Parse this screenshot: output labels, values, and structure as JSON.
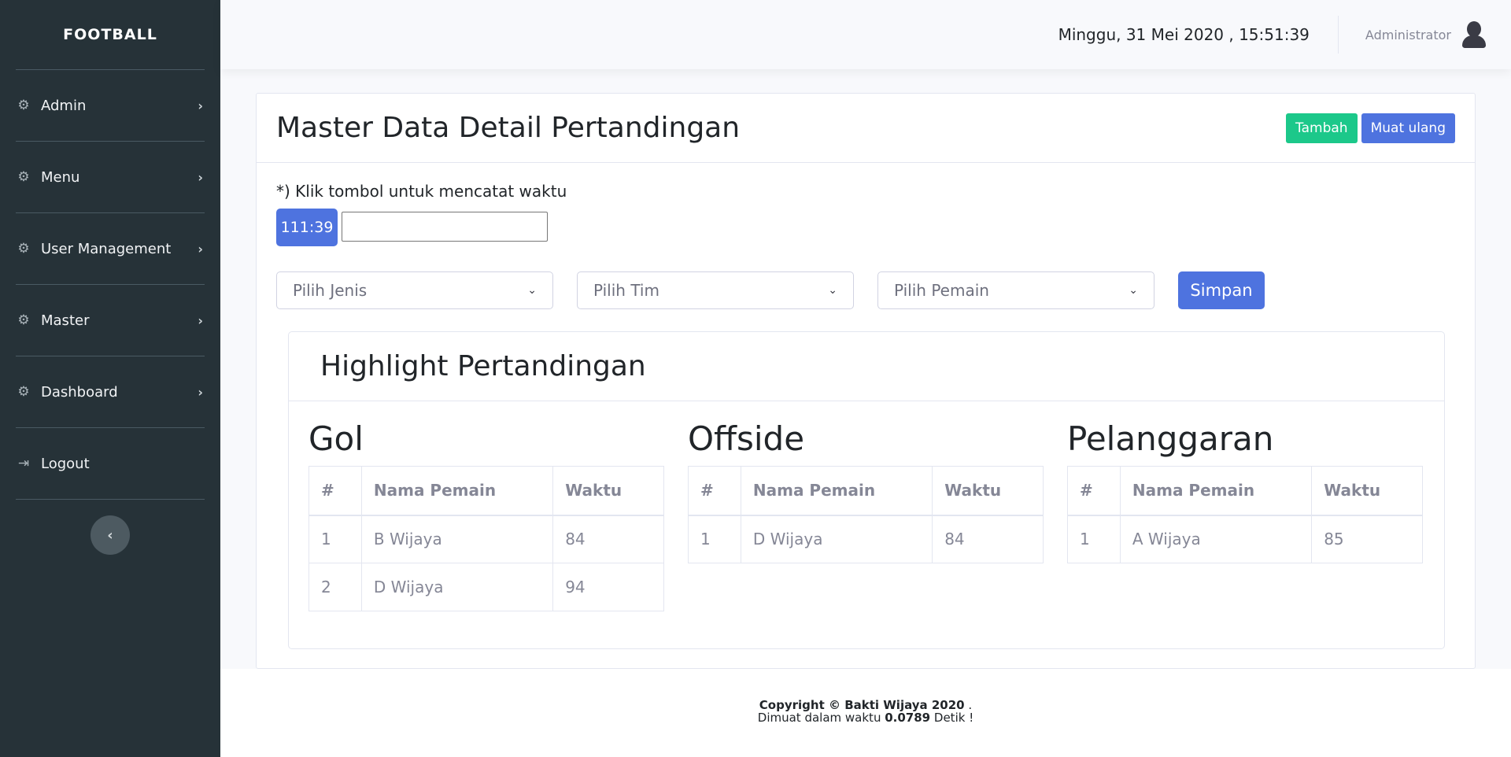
{
  "app": {
    "brand": "FOOTBALL"
  },
  "sidebar": {
    "items": [
      {
        "label": "Admin",
        "icon": "gear-icon"
      },
      {
        "label": "Menu",
        "icon": "gear-icon"
      },
      {
        "label": "User Management",
        "icon": "gear-icon"
      },
      {
        "label": "Master",
        "icon": "gear-icon"
      },
      {
        "label": "Dashboard",
        "icon": "gear-icon"
      }
    ],
    "logout_label": "Logout"
  },
  "topbar": {
    "datetime": "Minggu, 31 Mei 2020 , 15:51:39",
    "user_name": "Administrator"
  },
  "page": {
    "title": "Master Data Detail Pertandingan",
    "add_button": "Tambah",
    "reload_button": "Muat ulang",
    "hint": "*) Klik tombol untuk mencatat waktu",
    "timer_value": "111:39",
    "timer_input_value": "",
    "select_jenis": "Pilih Jenis",
    "select_tim": "Pilih Tim",
    "select_pemain": "Pilih Pemain",
    "save_button": "Simpan"
  },
  "highlight": {
    "title": "Highlight Pertandingan",
    "columns": [
      "#",
      "Nama Pemain",
      "Waktu"
    ],
    "gol": {
      "title": "Gol",
      "rows": [
        {
          "no": "1",
          "name": "B Wijaya",
          "time": "84"
        },
        {
          "no": "2",
          "name": "D Wijaya",
          "time": "94"
        }
      ]
    },
    "offside": {
      "title": "Offside",
      "rows": [
        {
          "no": "1",
          "name": "D Wijaya",
          "time": "84"
        }
      ]
    },
    "pelanggaran": {
      "title": "Pelanggaran",
      "rows": [
        {
          "no": "1",
          "name": "A Wijaya",
          "time": "85"
        }
      ]
    }
  },
  "footer": {
    "copyright_prefix": "Copyright © Bakti Wijaya 2020",
    "copyright_suffix": ".",
    "load_prefix": "Dimuat dalam waktu",
    "load_time": "0.0789",
    "load_suffix": "Detik !"
  },
  "colors": {
    "sidebar_bg": "#263238",
    "primary": "#4e73df",
    "success": "#1cc88a"
  }
}
